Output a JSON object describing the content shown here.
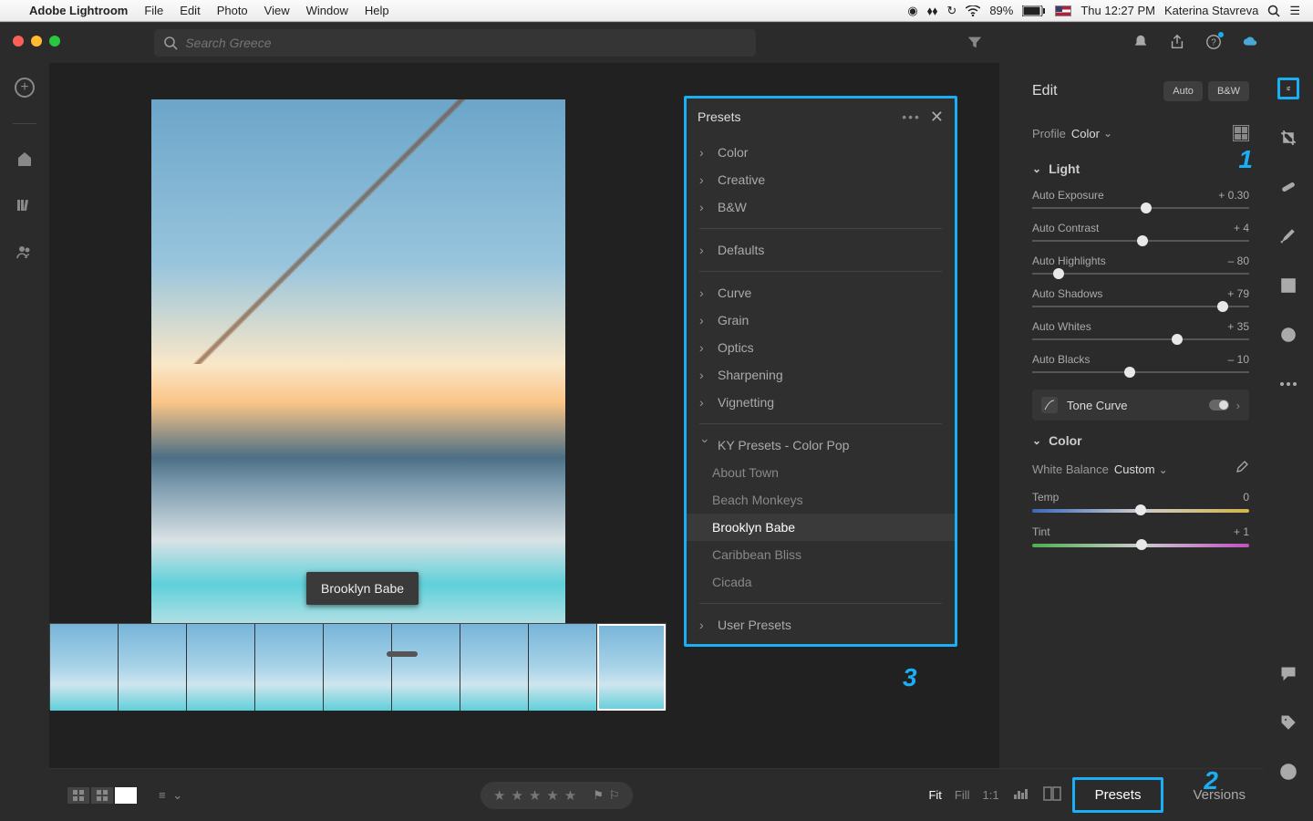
{
  "menubar": {
    "app_name": "Adobe Lightroom",
    "items": [
      "File",
      "Edit",
      "Photo",
      "View",
      "Window",
      "Help"
    ],
    "battery": "89%",
    "clock": "Thu 12:27 PM",
    "user": "Katerina Stavreva"
  },
  "search": {
    "placeholder": "Search Greece"
  },
  "tooltip": "Brooklyn Babe",
  "presets_panel": {
    "title": "Presets",
    "groups_top": [
      "Color",
      "Creative",
      "B&W"
    ],
    "groups_mid_first": "Defaults",
    "groups_mid": [
      "Curve",
      "Grain",
      "Optics",
      "Sharpening",
      "Vignetting"
    ],
    "custom_group": "KY Presets - Color Pop",
    "custom_presets": [
      "About Town",
      "Beach Monkeys",
      "Brooklyn Babe",
      "Caribbean Bliss",
      "Cicada"
    ],
    "selected_preset": "Brooklyn Babe",
    "user_group": "User Presets"
  },
  "edit": {
    "title": "Edit",
    "auto": "Auto",
    "bw": "B&W",
    "profile_label": "Profile",
    "profile_value": "Color",
    "light_title": "Light",
    "sliders": [
      {
        "label": "Auto Exposure",
        "value": "+ 0.30",
        "pos": 52.5
      },
      {
        "label": "Auto Contrast",
        "value": "+ 4",
        "pos": 51
      },
      {
        "label": "Auto Highlights",
        "value": "– 80",
        "pos": 12
      },
      {
        "label": "Auto Shadows",
        "value": "+ 79",
        "pos": 88
      },
      {
        "label": "Auto Whites",
        "value": "+ 35",
        "pos": 67
      },
      {
        "label": "Auto Blacks",
        "value": "– 10",
        "pos": 45
      }
    ],
    "tone_curve": "Tone Curve",
    "color_title": "Color",
    "wb_label": "White Balance",
    "wb_value": "Custom",
    "temp": {
      "label": "Temp",
      "value": "0",
      "pos": 50
    },
    "tint": {
      "label": "Tint",
      "value": "+ 1",
      "pos": 50.5
    }
  },
  "bottom": {
    "fit": "Fit",
    "fill": "Fill",
    "oneone": "1:1",
    "presets": "Presets",
    "versions": "Versions"
  },
  "annotations": {
    "n1": "1",
    "n2": "2",
    "n3": "3"
  }
}
